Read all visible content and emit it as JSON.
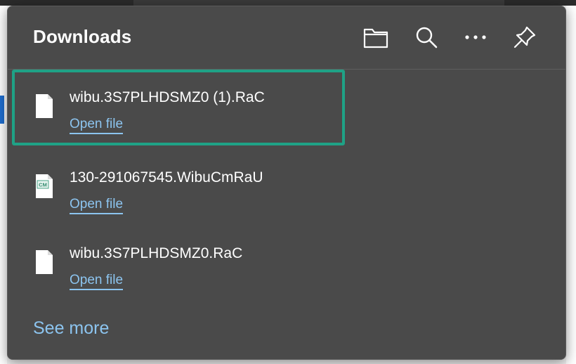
{
  "panel": {
    "title": "Downloads",
    "header_icons": [
      "folder-icon",
      "search-icon",
      "more-icon",
      "pin-icon"
    ]
  },
  "downloads": [
    {
      "file_name": "wibu.3S7PLHDSMZ0 (1).RaC",
      "action": "Open file",
      "icon": "file-icon",
      "selected": true
    },
    {
      "file_name": "130-291067545.WibuCmRaU",
      "action": "Open file",
      "icon": "cm-file-icon",
      "icon_text": "CM",
      "selected": false
    },
    {
      "file_name": "wibu.3S7PLHDSMZ0.RaC",
      "action": "Open file",
      "icon": "file-icon",
      "selected": false
    }
  ],
  "footer": {
    "see_more": "See more"
  },
  "colors": {
    "panel_bg": "#4a4a4a",
    "link": "#8cc4ef",
    "selection_border": "#1fa286"
  }
}
